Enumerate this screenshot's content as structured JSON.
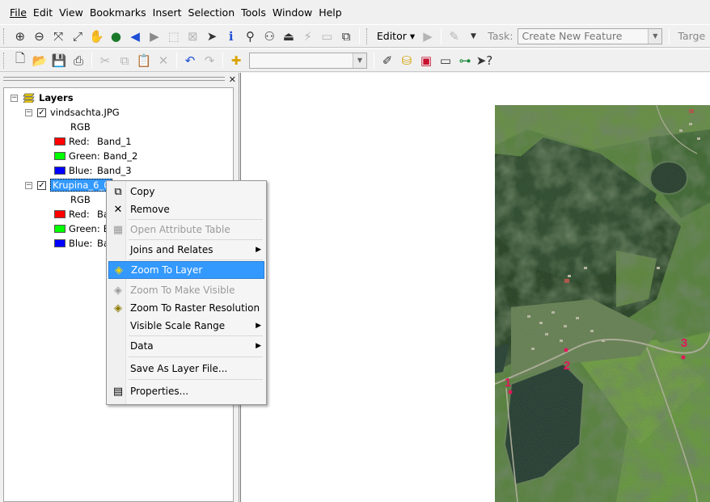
{
  "menu": {
    "items": [
      "File",
      "Edit",
      "View",
      "Bookmarks",
      "Insert",
      "Selection",
      "Tools",
      "Window",
      "Help"
    ]
  },
  "toolbar": {
    "editor_label": "Editor",
    "task_label": "Task:",
    "task_value": "Create New Feature",
    "target_label": "Targe"
  },
  "toc": {
    "root": "Layers",
    "layer1": {
      "name": "vindsachta.JPG",
      "rgb": "RGB",
      "red_label": "Red:",
      "red_band": "Band_1",
      "green_label": "Green:",
      "green_band": "Band_2",
      "blue_label": "Blue:",
      "blue_band": "Band_3"
    },
    "layer2": {
      "name": "Krupina_6_0",
      "rgb": "RGB",
      "red_label": "Red:",
      "red_band": "Ba",
      "green_label": "Green:",
      "green_band": "Ba",
      "blue_label": "Blue:",
      "blue_band": "Ba"
    },
    "colors": {
      "red": "#ff0000",
      "green": "#00ff00",
      "blue": "#0000ff"
    }
  },
  "context_menu": {
    "copy": "Copy",
    "remove": "Remove",
    "open_attr": "Open Attribute Table",
    "joins": "Joins and Relates",
    "zoom_layer": "Zoom To Layer",
    "zoom_visible": "Zoom To Make Visible",
    "zoom_raster": "Zoom To Raster Resolution",
    "scale_range": "Visible Scale Range",
    "data": "Data",
    "save_layer": "Save As Layer File...",
    "properties": "Properties..."
  },
  "map": {
    "markers": [
      "1",
      "2",
      "3"
    ],
    "marker_color": "#e0185a"
  }
}
